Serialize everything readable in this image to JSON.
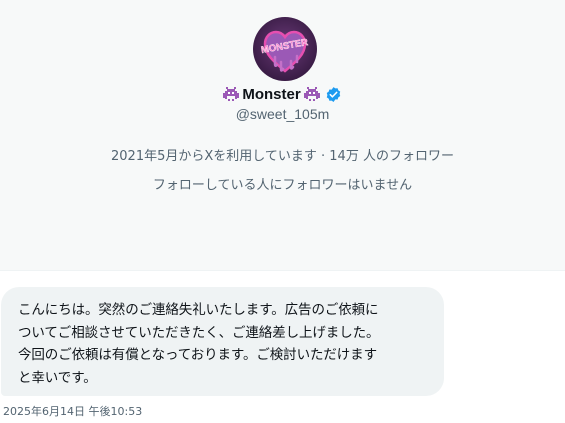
{
  "profile": {
    "display_name": "Monster",
    "name_emoji_left": "alien-monster-icon",
    "name_emoji_right": "alien-monster-icon",
    "verified": true,
    "handle": "@sweet_105m",
    "avatar_text": "MONSTER",
    "avatar_colors": {
      "background": "#3b1d47",
      "heart": "#e64fb0",
      "heart_fill": "#9b59b6"
    },
    "joined_text": "2021年5月からXを利用しています · 14万 人のフォロワー",
    "followers_you_know": "フォローしている人にフォロワーはいません"
  },
  "message": {
    "lines": [
      "こんにちは。突然のご連絡失礼いたします。広告のご依頼に",
      "ついてご相談させていただきたく、ご連絡差し上げました。",
      "今回のご依頼は有償となっております。ご検討いただけます",
      "と幸いです。"
    ],
    "timestamp": "2025年6月14日 午後10:53"
  },
  "colors": {
    "header_bg": "#f7f9f9",
    "bubble_bg": "#eff3f4",
    "secondary_text": "#536471",
    "verified_blue": "#1d9bf0",
    "emoji_purple": "#9b59b6"
  }
}
